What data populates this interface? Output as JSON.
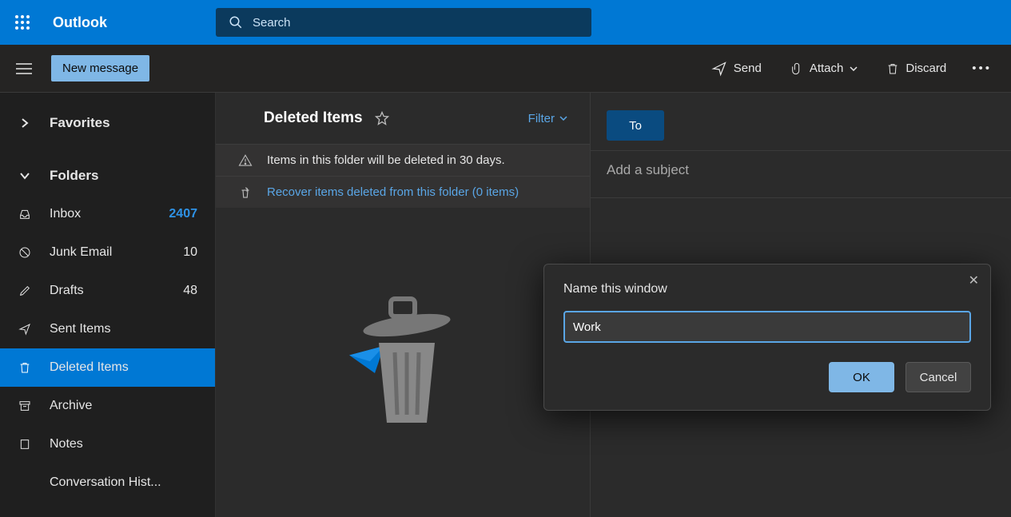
{
  "header": {
    "appTitle": "Outlook",
    "searchPlaceholder": "Search"
  },
  "commandBar": {
    "newMessage": "New message",
    "send": "Send",
    "attach": "Attach",
    "discard": "Discard"
  },
  "sidebar": {
    "favorites": "Favorites",
    "foldersLabel": "Folders",
    "items": [
      {
        "label": "Inbox",
        "count": "2407",
        "bold": true
      },
      {
        "label": "Junk Email",
        "count": "10"
      },
      {
        "label": "Drafts",
        "count": "48"
      },
      {
        "label": "Sent Items",
        "count": ""
      },
      {
        "label": "Deleted Items",
        "count": ""
      },
      {
        "label": "Archive",
        "count": ""
      },
      {
        "label": "Notes",
        "count": ""
      },
      {
        "label": "Conversation Hist...",
        "count": ""
      }
    ]
  },
  "listPane": {
    "title": "Deleted Items",
    "filter": "Filter",
    "info": "Items in this folder will be deleted in 30 days.",
    "recover": "Recover items deleted from this folder (0 items)"
  },
  "compose": {
    "to": "To",
    "subjectPlaceholder": "Add a subject"
  },
  "dialog": {
    "title": "Name this window",
    "value": "Work",
    "ok": "OK",
    "cancel": "Cancel"
  }
}
